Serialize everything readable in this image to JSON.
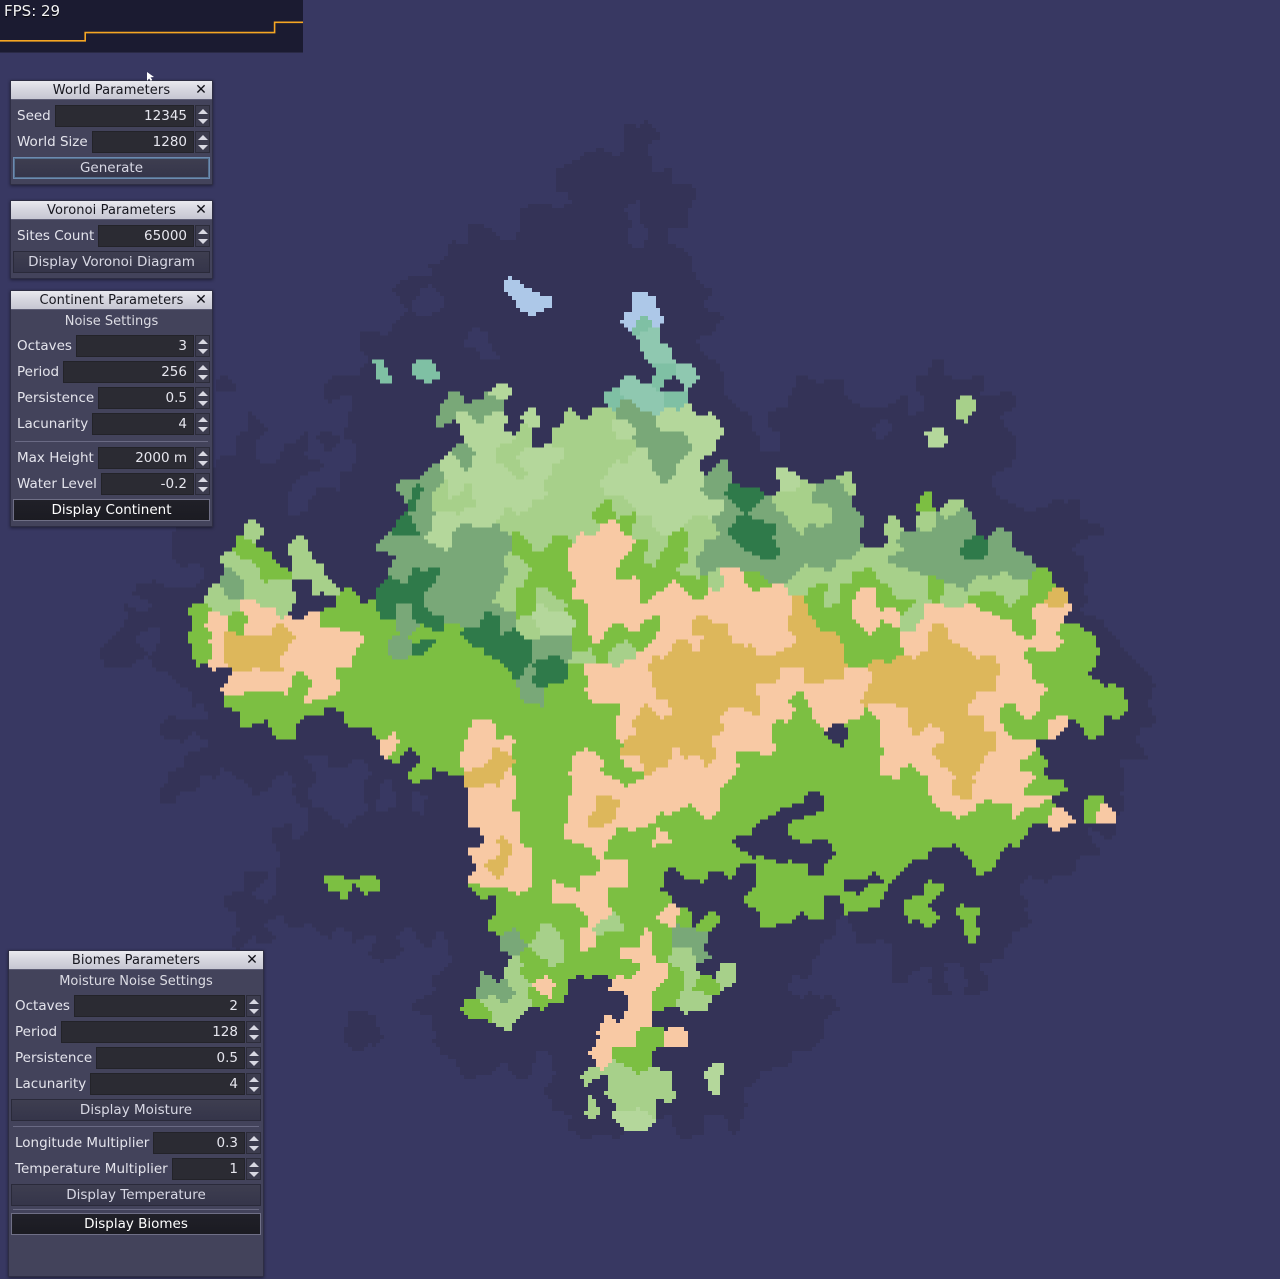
{
  "hud": {
    "fps_text": "FPS: 29",
    "graph_color": "#f5a623",
    "graph_bg": "#1b1b31",
    "fps_series": [
      29,
      29,
      29,
      29,
      29,
      29,
      29,
      29,
      29,
      33,
      33,
      33,
      33,
      33,
      33,
      33,
      33,
      33,
      33,
      33,
      33,
      33,
      33,
      33,
      33,
      33,
      33,
      33,
      33,
      38,
      38,
      38,
      38
    ]
  },
  "theme": {
    "background": "#383862",
    "panel_bg": "#43435b",
    "title_bg": "#d7d7e0",
    "field_bg": "#2b2b33",
    "text": "#e4e4ec",
    "accent_focus": "#6c8bb0"
  },
  "panels": {
    "world": {
      "title": "World Parameters",
      "close_label": "✕",
      "rows": [
        {
          "label": "Seed",
          "value": "12345"
        },
        {
          "label": "World Size",
          "value": "1280"
        }
      ],
      "generate_label": "Generate"
    },
    "voronoi": {
      "title": "Voronoi Parameters",
      "close_label": "✕",
      "rows": [
        {
          "label": "Sites Count",
          "value": "65000"
        }
      ],
      "display_label": "Display Voronoi Diagram"
    },
    "continent": {
      "title": "Continent Parameters",
      "close_label": "✕",
      "section_label": "Noise Settings",
      "noise_rows": [
        {
          "label": "Octaves",
          "value": "3"
        },
        {
          "label": "Period",
          "value": "256"
        },
        {
          "label": "Persistence",
          "value": "0.5"
        },
        {
          "label": "Lacunarity",
          "value": "4"
        }
      ],
      "height_rows": [
        {
          "label": "Max Height",
          "value": "2000 m"
        },
        {
          "label": "Water Level",
          "value": "-0.2"
        }
      ],
      "display_label": "Display Continent"
    },
    "biomes": {
      "title": "Biomes Parameters",
      "close_label": "✕",
      "section_label": "Moisture Noise Settings",
      "noise_rows": [
        {
          "label": "Octaves",
          "value": "2"
        },
        {
          "label": "Period",
          "value": "128"
        },
        {
          "label": "Persistence",
          "value": "0.5"
        },
        {
          "label": "Lacunarity",
          "value": "4"
        }
      ],
      "display_moisture_label": "Display Moisture",
      "temp_rows": [
        {
          "label": "Longitude Multiplier",
          "value": "0.3"
        },
        {
          "label": "Temperature Multiplier",
          "value": "1"
        }
      ],
      "display_temperature_label": "Display Temperature",
      "display_biomes_label": "Display Biomes"
    }
  },
  "map": {
    "mode": "Display Biomes",
    "seed": 12345,
    "world_size": 1280,
    "water_level": -0.2,
    "ocean_color": "#383862",
    "deep_color": "#343357",
    "biome_palette": {
      "ice": "#ffffff",
      "tundra": "#adc8e8",
      "taiga": "#8fc8b0",
      "boreal": "#7fc0a4",
      "grassland": "#a7d08a",
      "plains": "#b4d79b",
      "forest": "#79a878",
      "deep_forest": "#2f7a4a",
      "jungle": "#7cbf42",
      "savanna": "#ddb75b",
      "desert": "#f8c9a4",
      "swamp": "#5fb39a"
    }
  }
}
